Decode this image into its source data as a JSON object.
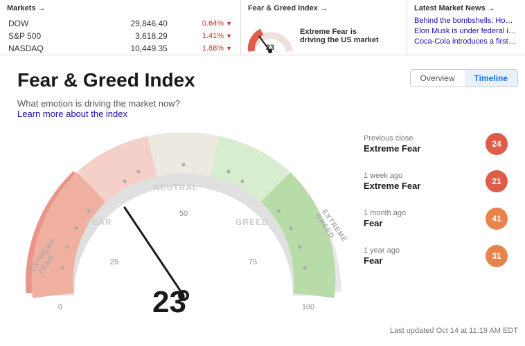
{
  "topNav": {
    "markets": {
      "title": "Markets →",
      "rows": [
        {
          "label": "DOW",
          "value": "29,846.40",
          "change": "0.64%",
          "direction": "down"
        },
        {
          "label": "S&P 500",
          "value": "3,618.29",
          "change": "1.41%",
          "direction": "down"
        },
        {
          "label": "NASDAQ",
          "value": "10,449.35",
          "change": "1.88%",
          "direction": "down"
        }
      ]
    },
    "fearGreed": {
      "title": "Fear & Greed Index →",
      "score": "23",
      "description": "Extreme Fear is driving the US market"
    },
    "news": {
      "title": "Latest Market News →",
      "items": [
        "Behind the bombshells: How the l...",
        "Elon Musk is under federal investi...",
        "Coca-Cola introduces a first-of-its..."
      ]
    }
  },
  "main": {
    "title": "Fear & Greed Index",
    "subtitle": "What emotion is driving the market now?",
    "learnLink": "Learn more about the index",
    "tabs": [
      {
        "label": "Overview",
        "active": false
      },
      {
        "label": "Timeline",
        "active": true
      }
    ],
    "currentScore": "23",
    "gaugeLabels": {
      "extremeFear": "EXTREME\nFEAR",
      "fear": "FEAR",
      "neutral": "NEUTRAL",
      "greed": "GREED",
      "extremeGreed": "EXTREME\nGREED"
    },
    "axisLabels": [
      "0",
      "25",
      "50",
      "75",
      "100"
    ],
    "stats": [
      {
        "period": "Previous close",
        "label": "Extreme Fear",
        "score": "24",
        "badgeClass": "fear"
      },
      {
        "period": "1 week ago",
        "label": "Extreme Fear",
        "score": "21",
        "badgeClass": "fear"
      },
      {
        "period": "1 month ago",
        "label": "Fear",
        "score": "41",
        "badgeClass": "mild-fear"
      },
      {
        "period": "1 year ago",
        "label": "Fear",
        "score": "31",
        "badgeClass": "mild-fear"
      }
    ],
    "lastUpdated": "Last updated Oct 14 at 11:19 AM EDT"
  }
}
